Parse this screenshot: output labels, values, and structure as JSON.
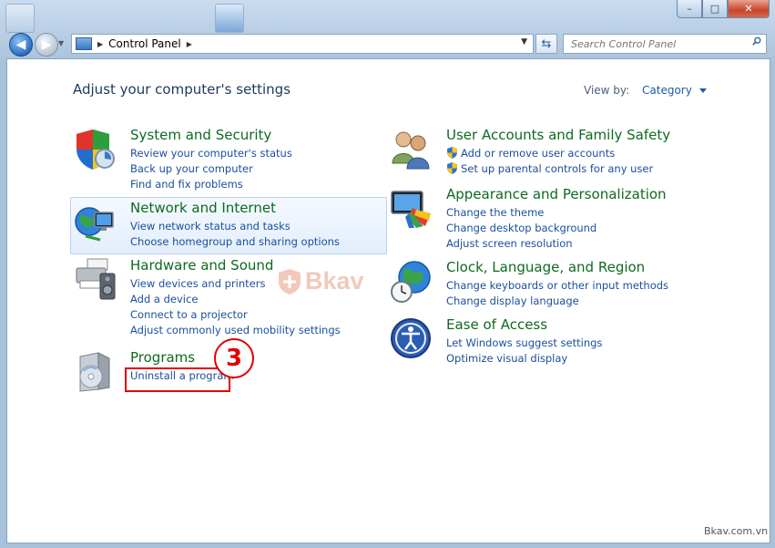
{
  "window": {
    "minimize": "–",
    "maximize": "□",
    "close": "✕"
  },
  "address": {
    "crumb": "Control Panel"
  },
  "search": {
    "placeholder": "Search Control Panel"
  },
  "page": {
    "heading": "Adjust your computer's settings",
    "view_by_label": "View by:",
    "view_by_value": "Category"
  },
  "categories": [
    {
      "title": "System and Security",
      "icon": "shield-icon",
      "links": [
        "Review your computer's status",
        "Back up your computer",
        "Find and fix problems"
      ]
    },
    {
      "title": "Network and Internet",
      "icon": "network-globe-icon",
      "links": [
        "View network status and tasks",
        "Choose homegroup and sharing options"
      ]
    },
    {
      "title": "Hardware and Sound",
      "icon": "printer-speaker-icon",
      "links": [
        "View devices and printers",
        "Add a device",
        "Connect to a projector",
        "Adjust commonly used mobility settings"
      ]
    },
    {
      "title": "Programs",
      "icon": "programs-disc-icon",
      "links": [
        "Uninstall a program"
      ]
    },
    {
      "title": "User Accounts and Family Safety",
      "icon": "users-icon",
      "links": [
        "Add or remove user accounts",
        "Set up parental controls for any user"
      ]
    },
    {
      "title": "Appearance and Personalization",
      "icon": "monitor-palette-icon",
      "links": [
        "Change the theme",
        "Change desktop background",
        "Adjust screen resolution"
      ]
    },
    {
      "title": "Clock, Language, and Region",
      "icon": "clock-globe-icon",
      "links": [
        "Change keyboards or other input methods",
        "Change display language"
      ]
    },
    {
      "title": "Ease of Access",
      "icon": "ease-of-access-icon",
      "links": [
        "Let Windows suggest settings",
        "Optimize visual display"
      ]
    }
  ],
  "annotation": {
    "step": "3"
  },
  "watermark": {
    "text": "Bkav"
  },
  "credit": "Bkav.com.vn"
}
